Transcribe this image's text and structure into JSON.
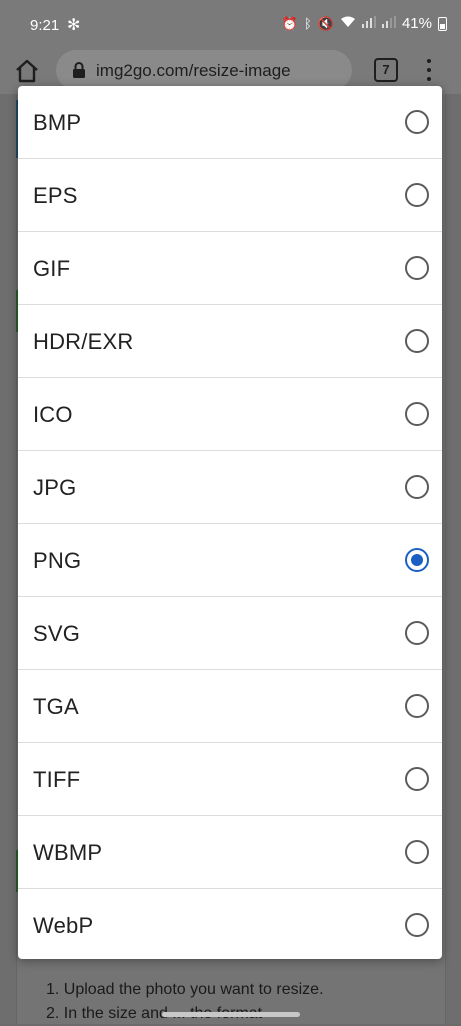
{
  "status_bar": {
    "time": "9:21",
    "battery": "41%",
    "fan_icon": "✻"
  },
  "browser": {
    "url": "img2go.com/resize-image",
    "tab_count": "7"
  },
  "dialog": {
    "options": [
      {
        "label": "BMP",
        "selected": false
      },
      {
        "label": "EPS",
        "selected": false
      },
      {
        "label": "GIF",
        "selected": false
      },
      {
        "label": "HDR/EXR",
        "selected": false
      },
      {
        "label": "ICO",
        "selected": false
      },
      {
        "label": "JPG",
        "selected": false
      },
      {
        "label": "PNG",
        "selected": true
      },
      {
        "label": "SVG",
        "selected": false
      },
      {
        "label": "TGA",
        "selected": false
      },
      {
        "label": "TIFF",
        "selected": false
      },
      {
        "label": "WBMP",
        "selected": false
      },
      {
        "label": "WebP",
        "selected": false
      }
    ]
  },
  "page": {
    "instructions": [
      "1. Upload the photo you want to resize.",
      "2. In the size and ... the format"
    ]
  },
  "colors": {
    "accent": "#1a5fc4",
    "scrim": "#6e6e6e"
  }
}
